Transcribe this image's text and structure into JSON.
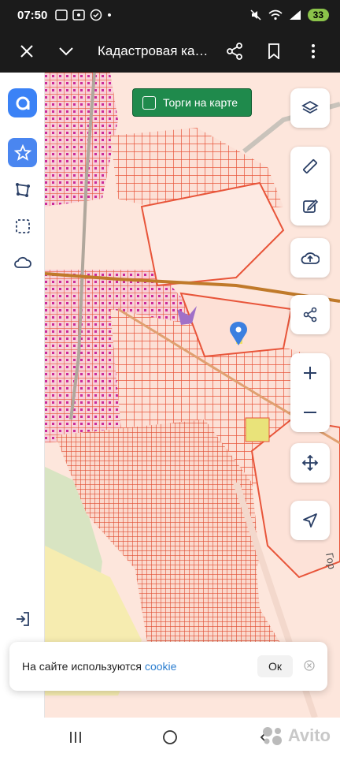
{
  "status": {
    "time": "07:50",
    "battery": "33"
  },
  "appbar": {
    "title": "Кадастровая ка…"
  },
  "map": {
    "torgi_label": "Торги на карте",
    "place_label": "Гор"
  },
  "cookie": {
    "text": "На сайте используются",
    "link": "cookie",
    "ok": "Ок"
  },
  "watermark": "Avito",
  "colors": {
    "parcel": "#e8553a",
    "accent": "#4a86f0",
    "torgi": "#1f8a4c"
  }
}
